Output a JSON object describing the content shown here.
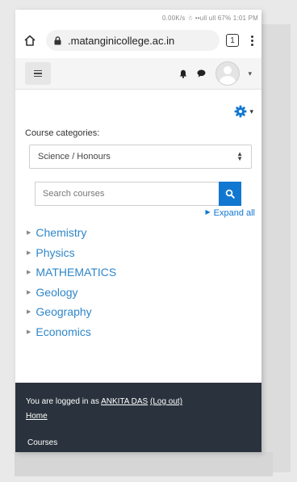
{
  "status_bar": {
    "text": "0.00K/s ☃ ••ull ull 67% 1:01 PM"
  },
  "browser": {
    "url": ".matanginicollege.ac.in",
    "tab_count": "1"
  },
  "page": {
    "course_categories_label": "Course categories:",
    "category_select_value": "Science / Honours",
    "search": {
      "placeholder": "Search courses"
    },
    "expand_all": "Expand all",
    "categories": [
      {
        "label": "Chemistry"
      },
      {
        "label": "Physics"
      },
      {
        "label": "MATHEMATICS"
      },
      {
        "label": "Geology"
      },
      {
        "label": "Geography"
      },
      {
        "label": "Economics"
      }
    ]
  },
  "footer": {
    "logged_prefix": "You are logged in as",
    "user_name": "ANKITA DAS",
    "logout": "(Log out)",
    "home": "Home",
    "courses": "Courses"
  },
  "colors": {
    "accent": "#1177d1",
    "link": "#2f86c9",
    "footer_bg": "#2a333d"
  }
}
